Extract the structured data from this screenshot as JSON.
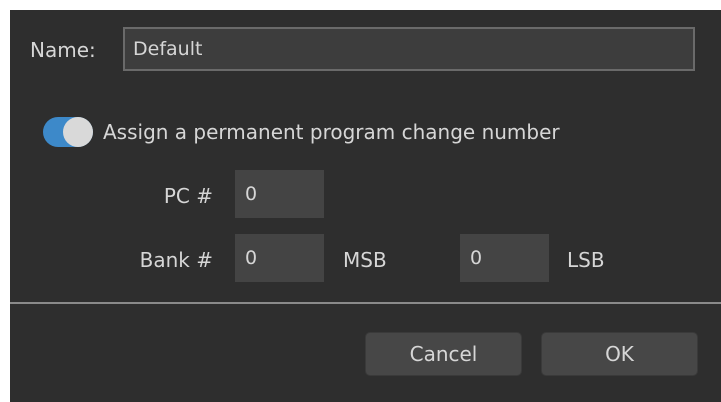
{
  "name_field": {
    "label": "Name:",
    "value": "Default"
  },
  "assign_toggle": {
    "label": "Assign a permanent program change number",
    "checked": true,
    "accent_color": "#3d89c9"
  },
  "pc": {
    "label": "PC #",
    "value": "0"
  },
  "bank": {
    "label": "Bank #",
    "msb_value": "0",
    "msb_label": "MSB",
    "lsb_value": "0",
    "lsb_label": "LSB"
  },
  "buttons": {
    "cancel_label": "Cancel",
    "ok_label": "OK"
  }
}
